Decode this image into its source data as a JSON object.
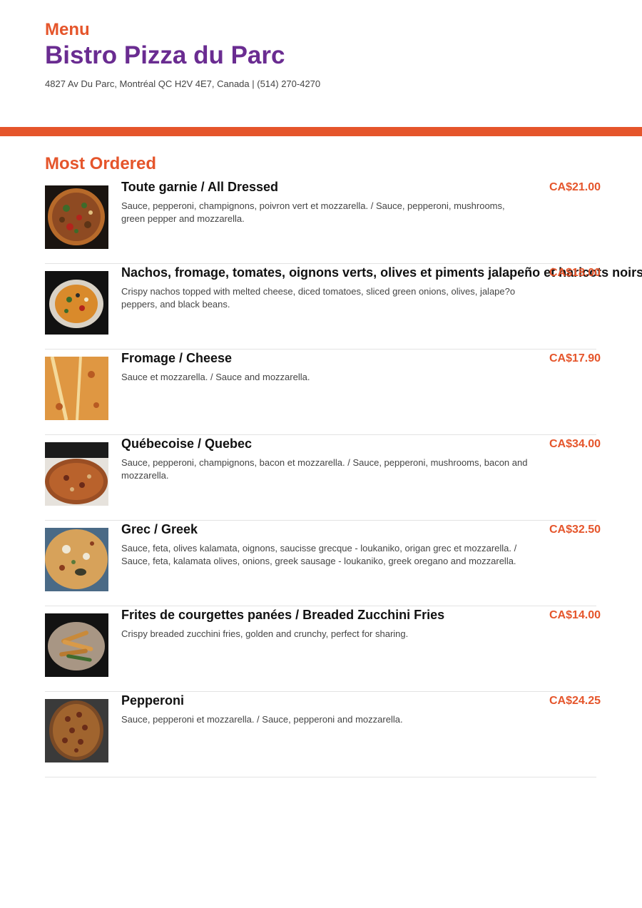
{
  "header": {
    "menu_label": "Menu",
    "restaurant_name": "Bistro Pizza du Parc",
    "address_line": "4827 Av Du Parc, Montréal QC H2V 4E7, Canada | (514) 270-4270"
  },
  "colors": {
    "accent": "#e5552b",
    "brand": "#6a2c91"
  },
  "section": {
    "title": "Most Ordered"
  },
  "items": [
    {
      "name": "Toute garnie / All Dressed",
      "description": "Sauce, pepperoni, champignons, poivron vert et mozzarella. / Sauce, pepperoni, mushrooms, green pepper and mozzarella.",
      "price": "CA$21.00",
      "image": "all-dressed-pizza-photo"
    },
    {
      "name": "Nachos, fromage, tomates, oignons verts, olives et piments jalapeño et haricots noirs",
      "description": "Crispy nachos topped with melted cheese, diced tomatoes, sliced green onions, olives, jalape?o peppers, and black beans.",
      "price": "CA$18.00",
      "image": "nachos-photo"
    },
    {
      "name": "Fromage / Cheese",
      "description": "Sauce et mozzarella. / Sauce and mozzarella.",
      "price": "CA$17.90",
      "image": "cheese-pizza-photo"
    },
    {
      "name": "Québecoise / Quebec",
      "description": "Sauce, pepperoni, champignons, bacon et mozzarella. / Sauce, pepperoni, mushrooms, bacon and mozzarella.",
      "price": "CA$34.00",
      "image": "quebec-pizza-photo"
    },
    {
      "name": "Grec / Greek",
      "description": "Sauce, feta, olives kalamata, oignons, saucisse grecque - loukaniko, origan grec et mozzarella. / Sauce, feta, kalamata olives, onions, greek sausage - loukaniko, greek oregano and mozzarella.",
      "price": "CA$32.50",
      "image": "greek-pizza-photo"
    },
    {
      "name": "Frites de courgettes panées / Breaded Zucchini Fries",
      "description": "Crispy breaded zucchini fries, golden and crunchy, perfect for sharing.",
      "price": "CA$14.00",
      "image": "zucchini-fries-photo"
    },
    {
      "name": "Pepperoni",
      "description": "Sauce, pepperoni et mozzarella. / Sauce, pepperoni and mozzarella.",
      "price": "CA$24.25",
      "image": "pepperoni-pizza-photo"
    }
  ]
}
